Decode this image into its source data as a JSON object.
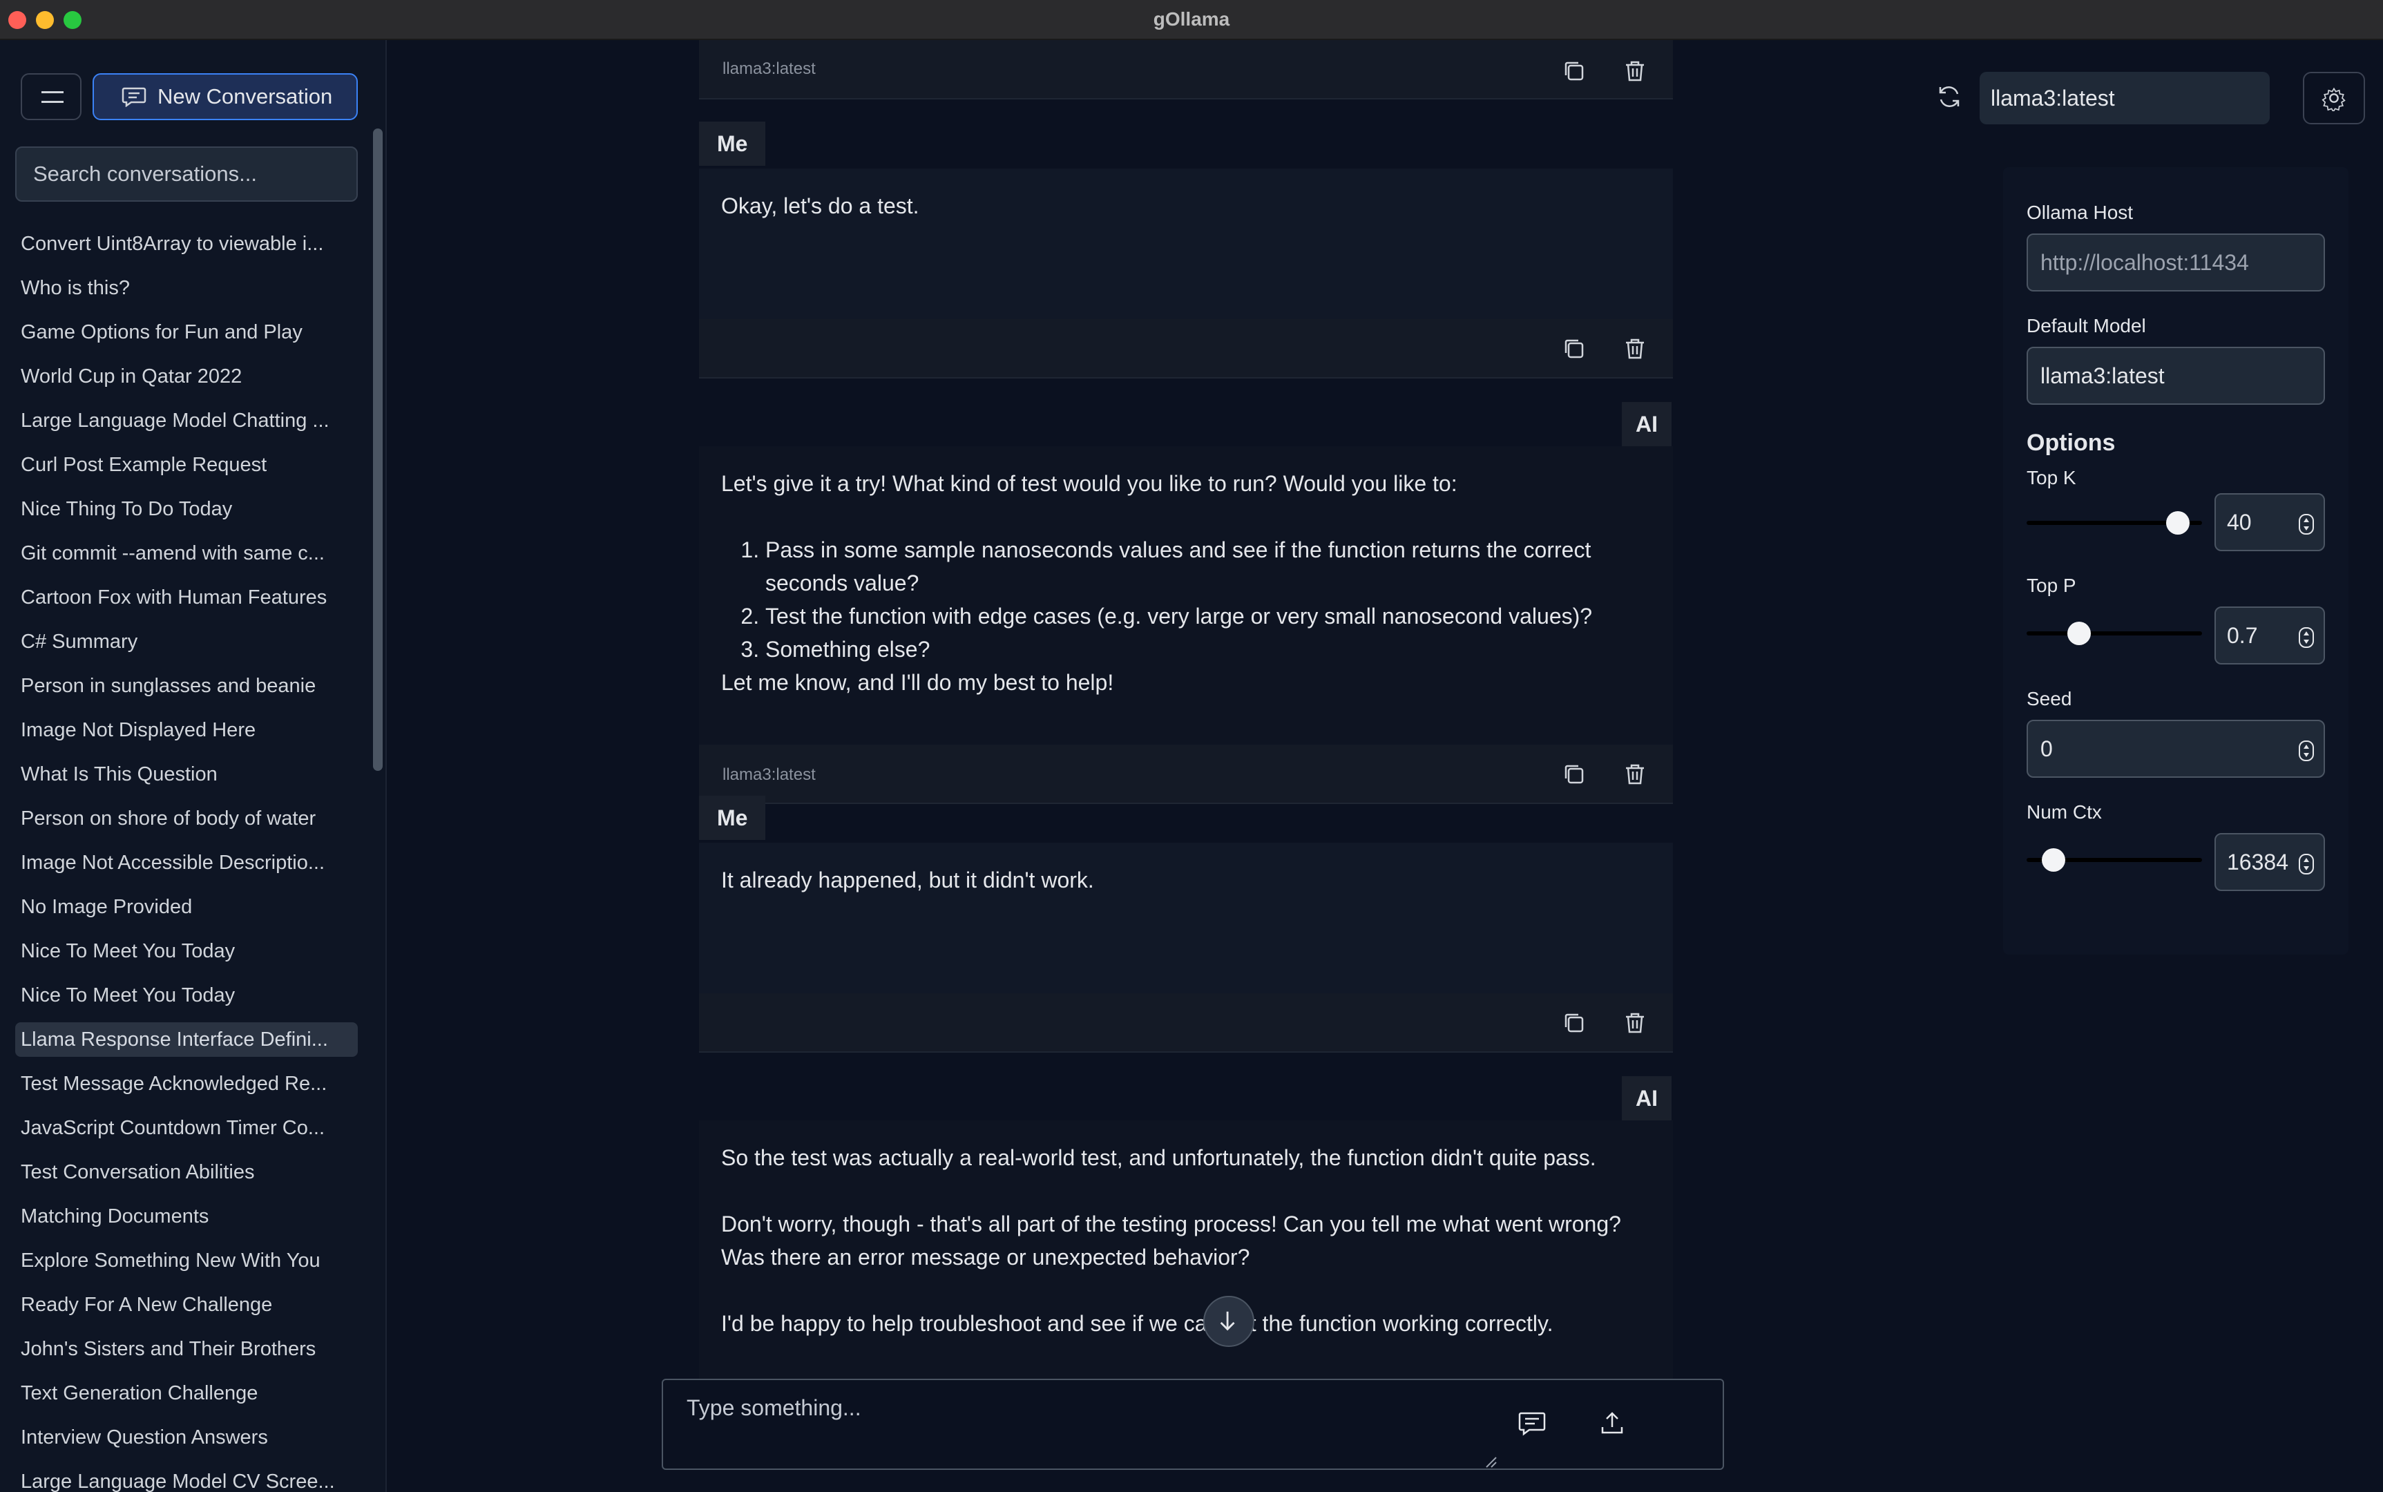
{
  "window": {
    "title": "gOllama"
  },
  "sidebar": {
    "new_conversation_label": "New Conversation",
    "search_placeholder": "Search conversations...",
    "conversations": [
      "Convert Uint8Array to viewable i...",
      "Who is this?",
      "Game Options for Fun and Play",
      "World Cup in Qatar 2022",
      "Large Language Model Chatting ...",
      "Curl Post Example Request",
      "Nice Thing To Do Today",
      "Git commit --amend with same c...",
      "Cartoon Fox with Human Features",
      "C# Summary",
      "Person in sunglasses and beanie",
      "Image Not Displayed Here",
      "What Is This Question",
      "Person on shore of body of water",
      "Image Not Accessible Descriptio...",
      "No Image Provided",
      "Nice To Meet You Today",
      "Nice To Meet You Today",
      "Llama Response Interface Defini...",
      "Test Message Acknowledged Re...",
      "JavaScript Countdown Timer Co...",
      "Test Conversation Abilities",
      "Matching Documents",
      "Explore Something New With You",
      "Ready For A New Challenge",
      "John's Sisters and Their Brothers",
      "Text Generation Challenge",
      "Interview Question Answers",
      "Large Language Model CV Scree..."
    ],
    "active_conversation": "Llama Response Interface Defini..."
  },
  "header": {
    "model": "llama3:latest"
  },
  "chat": {
    "model_tag": "llama3:latest",
    "me_label": "Me",
    "ai_label": "AI",
    "messages": {
      "user1": "Okay, let's do a test.",
      "ai1_intro": "Let's give it a try! What kind of test would you like to run? Would you like to:",
      "ai1_items": [
        "Pass in some sample nanoseconds values and see if the function returns the correct seconds value?",
        "Test the function with edge cases (e.g. very large or very small nanosecond values)?",
        "Something else?"
      ],
      "ai1_outro": "Let me know, and I'll do my best to help!",
      "user2": "It already happened, but it didn't work.",
      "ai2_p1": "So the test was actually a real-world test, and unfortunately, the function didn't quite pass.",
      "ai2_p2": "Don't worry, though - that's all part of the testing process! Can you tell me what went wrong? Was there an error message or unexpected behavior?",
      "ai2_p3": "I'd be happy to help troubleshoot and see if we can get the function working correctly."
    },
    "composer_placeholder": "Type something..."
  },
  "settings": {
    "host_label": "Ollama Host",
    "host_placeholder": "http://localhost:11434",
    "default_model_label": "Default Model",
    "default_model_value": "llama3:latest",
    "options_heading": "Options",
    "top_k": {
      "label": "Top K",
      "value": "40",
      "slider_fraction": 0.92
    },
    "top_p": {
      "label": "Top P",
      "value": "0.7",
      "slider_fraction": 0.27
    },
    "seed": {
      "label": "Seed",
      "value": "0"
    },
    "num_ctx": {
      "label": "Num Ctx",
      "value": "16384",
      "slider_fraction": 0.1
    }
  },
  "colors": {
    "accent": "#3b82f6",
    "background": "#0b1120",
    "sidebar": "#0e1524"
  }
}
